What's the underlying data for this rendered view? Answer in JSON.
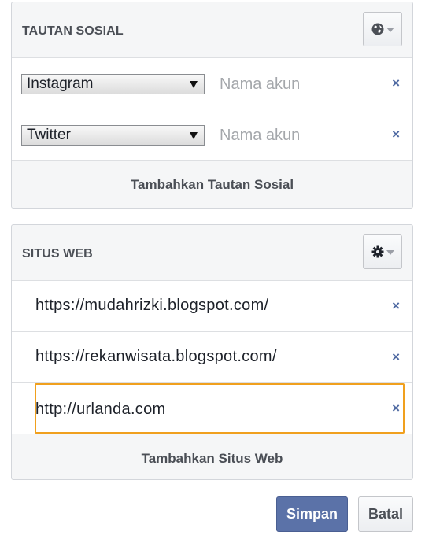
{
  "social": {
    "title": "TAUTAN SOSIAL",
    "header_icon": "globe-icon",
    "rows": [
      {
        "platform": "Instagram",
        "placeholder": "Nama akun",
        "remove": "×"
      },
      {
        "platform": "Twitter",
        "placeholder": "Nama akun",
        "remove": "×"
      }
    ],
    "add_label": "Tambahkan Tautan Sosial"
  },
  "web": {
    "title": "SITUS WEB",
    "header_icon": "gear-icon",
    "urls": [
      {
        "text": "https://mudahrizki.blogspot.com/",
        "remove": "×"
      },
      {
        "text": "https://rekanwisata.blogspot.com/",
        "remove": "×"
      }
    ],
    "active_input": {
      "value": "http://urlanda.com",
      "remove": "×"
    },
    "add_label": "Tambahkan Situs Web"
  },
  "actions": {
    "save_label": "Simpan",
    "cancel_label": "Batal"
  },
  "colors": {
    "accent": "#5b72a8",
    "focus": "#f0a01e",
    "remove": "#4e69a2"
  }
}
